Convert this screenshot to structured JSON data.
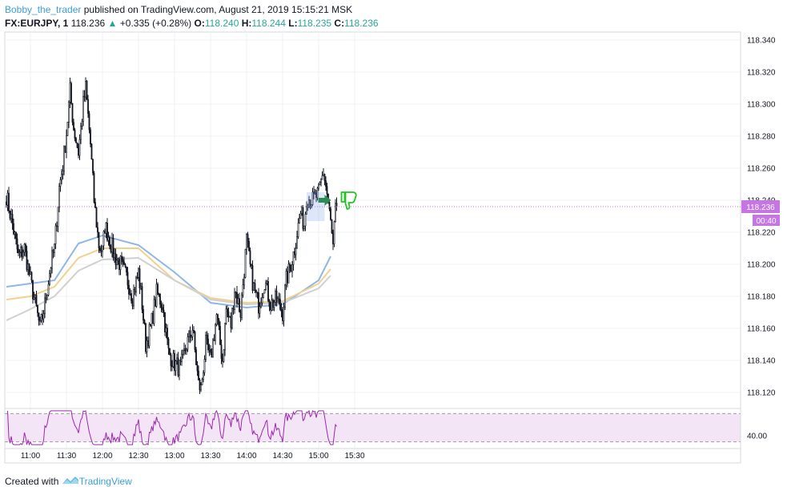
{
  "header": {
    "author": "Bobby_the_trader",
    "published_text": " published on TradingView.com, August 21, 2019 15:15:21 MSK",
    "symbol": "FX:EURJPY, 1",
    "last": "118.236",
    "up_arrow": "▲",
    "change": "+0.335 (+0.28%)",
    "open_label": "O:",
    "open": "118.240",
    "high_label": "H:",
    "high": "118.244",
    "low_label": "L:",
    "low": "118.235",
    "close_label": "C:",
    "close": "118.236"
  },
  "footer": {
    "created_with": "Created with",
    "brand": "TradingView"
  },
  "price_tag": {
    "value": "118.236",
    "countdown": "00:40",
    "color": "#c576e4"
  },
  "colors": {
    "candle_body": "#131722",
    "ma_fast": "#90b6e6",
    "ma_mid": "#f0d28e",
    "ma_slow": "#d0d0d0",
    "rsi_line": "#9c27b0",
    "rsi_band": "#f3e5f5",
    "grid": "#eef0f3"
  },
  "chart_data": {
    "type": "candlestick",
    "y_range": [
      118.11,
      118.345
    ],
    "y_ticks": [
      "118.340",
      "118.320",
      "118.300",
      "118.280",
      "118.260",
      "118.240",
      "118.220",
      "118.200",
      "118.180",
      "118.160",
      "118.140",
      "118.120"
    ],
    "x_ticks": [
      "11:00",
      "11:30",
      "12:00",
      "12:30",
      "13:00",
      "13:30",
      "14:00",
      "14:30",
      "15:00",
      "15:30"
    ],
    "x_start": "10:40",
    "candle_minutes": 1,
    "close_path": [
      [
        "10:40",
        118.243
      ],
      [
        "10:45",
        118.225
      ],
      [
        "10:50",
        118.205
      ],
      [
        "10:55",
        118.21
      ],
      [
        "11:00",
        118.19
      ],
      [
        "11:05",
        118.172
      ],
      [
        "11:08",
        118.16
      ],
      [
        "11:12",
        118.175
      ],
      [
        "11:17",
        118.2
      ],
      [
        "11:20",
        118.21
      ],
      [
        "11:24",
        118.248
      ],
      [
        "11:27",
        118.262
      ],
      [
        "11:30",
        118.282
      ],
      [
        "11:33",
        118.308
      ],
      [
        "11:36",
        118.285
      ],
      [
        "11:40",
        118.27
      ],
      [
        "11:44",
        118.3
      ],
      [
        "11:46",
        118.31
      ],
      [
        "11:50",
        118.275
      ],
      [
        "11:53",
        118.24
      ],
      [
        "11:57",
        118.212
      ],
      [
        "12:00",
        118.208
      ],
      [
        "12:02",
        118.224
      ],
      [
        "12:05",
        118.218
      ],
      [
        "12:10",
        118.205
      ],
      [
        "12:15",
        118.2
      ],
      [
        "12:20",
        118.192
      ],
      [
        "12:25",
        118.18
      ],
      [
        "12:30",
        118.195
      ],
      [
        "12:33",
        118.175
      ],
      [
        "12:36",
        118.15
      ],
      [
        "12:40",
        118.16
      ],
      [
        "12:45",
        118.182
      ],
      [
        "12:50",
        118.175
      ],
      [
        "12:55",
        118.145
      ],
      [
        "13:00",
        118.138
      ],
      [
        "13:05",
        118.135
      ],
      [
        "13:10",
        118.15
      ],
      [
        "13:15",
        118.16
      ],
      [
        "13:20",
        118.125
      ],
      [
        "13:22",
        118.122
      ],
      [
        "13:26",
        118.15
      ],
      [
        "13:30",
        118.14
      ],
      [
        "13:35",
        118.168
      ],
      [
        "13:38",
        118.15
      ],
      [
        "13:40",
        118.14
      ],
      [
        "13:43",
        118.172
      ],
      [
        "13:47",
        118.162
      ],
      [
        "13:50",
        118.185
      ],
      [
        "13:55",
        118.17
      ],
      [
        "14:00",
        118.215
      ],
      [
        "14:03",
        118.198
      ],
      [
        "14:06",
        118.185
      ],
      [
        "14:10",
        118.175
      ],
      [
        "14:15",
        118.19
      ],
      [
        "14:20",
        118.175
      ],
      [
        "14:25",
        118.178
      ],
      [
        "14:30",
        118.17
      ],
      [
        "14:33",
        118.19
      ],
      [
        "14:37",
        118.2
      ],
      [
        "14:40",
        118.21
      ],
      [
        "14:42",
        118.22
      ],
      [
        "14:45",
        118.232
      ],
      [
        "14:48",
        118.225
      ],
      [
        "14:50",
        118.242
      ],
      [
        "14:55",
        118.24
      ],
      [
        "15:00",
        118.244
      ],
      [
        "15:04",
        118.258
      ],
      [
        "15:07",
        118.244
      ],
      [
        "15:10",
        118.226
      ],
      [
        "15:12",
        118.21
      ],
      [
        "15:14",
        118.234
      ],
      [
        "15:15",
        118.236
      ]
    ],
    "overlays": [
      {
        "name": "",
        "color": "#90b6e6",
        "points": [
          [
            "10:40",
            118.186
          ],
          [
            "11:00",
            118.188
          ],
          [
            "11:20",
            118.19
          ],
          [
            "11:40",
            118.213
          ],
          [
            "12:00",
            118.218
          ],
          [
            "12:30",
            118.212
          ],
          [
            "13:00",
            118.195
          ],
          [
            "13:30",
            118.176
          ],
          [
            "14:00",
            118.173
          ],
          [
            "14:30",
            118.175
          ],
          [
            "15:00",
            118.19
          ],
          [
            "15:10",
            118.205
          ]
        ]
      },
      {
        "name": "",
        "color": "#f0d28e",
        "points": [
          [
            "10:40",
            118.178
          ],
          [
            "11:00",
            118.18
          ],
          [
            "11:20",
            118.186
          ],
          [
            "11:40",
            118.204
          ],
          [
            "12:00",
            118.21
          ],
          [
            "12:30",
            118.21
          ],
          [
            "13:00",
            118.19
          ],
          [
            "13:30",
            118.179
          ],
          [
            "14:00",
            118.176
          ],
          [
            "14:30",
            118.177
          ],
          [
            "15:00",
            118.188
          ],
          [
            "15:10",
            118.197
          ]
        ]
      },
      {
        "name": "",
        "color": "#d0d0d0",
        "points": [
          [
            "10:40",
            118.165
          ],
          [
            "11:00",
            118.172
          ],
          [
            "11:20",
            118.18
          ],
          [
            "11:40",
            118.196
          ],
          [
            "12:00",
            118.203
          ],
          [
            "12:30",
            118.204
          ],
          [
            "13:00",
            118.19
          ],
          [
            "13:30",
            118.178
          ],
          [
            "14:00",
            118.175
          ],
          [
            "14:30",
            118.176
          ],
          [
            "15:00",
            118.185
          ],
          [
            "15:10",
            118.193
          ]
        ]
      }
    ],
    "rsi": {
      "level_label": "40.00",
      "upper": 70,
      "lower": 30,
      "display_range": [
        25,
        75
      ]
    }
  }
}
